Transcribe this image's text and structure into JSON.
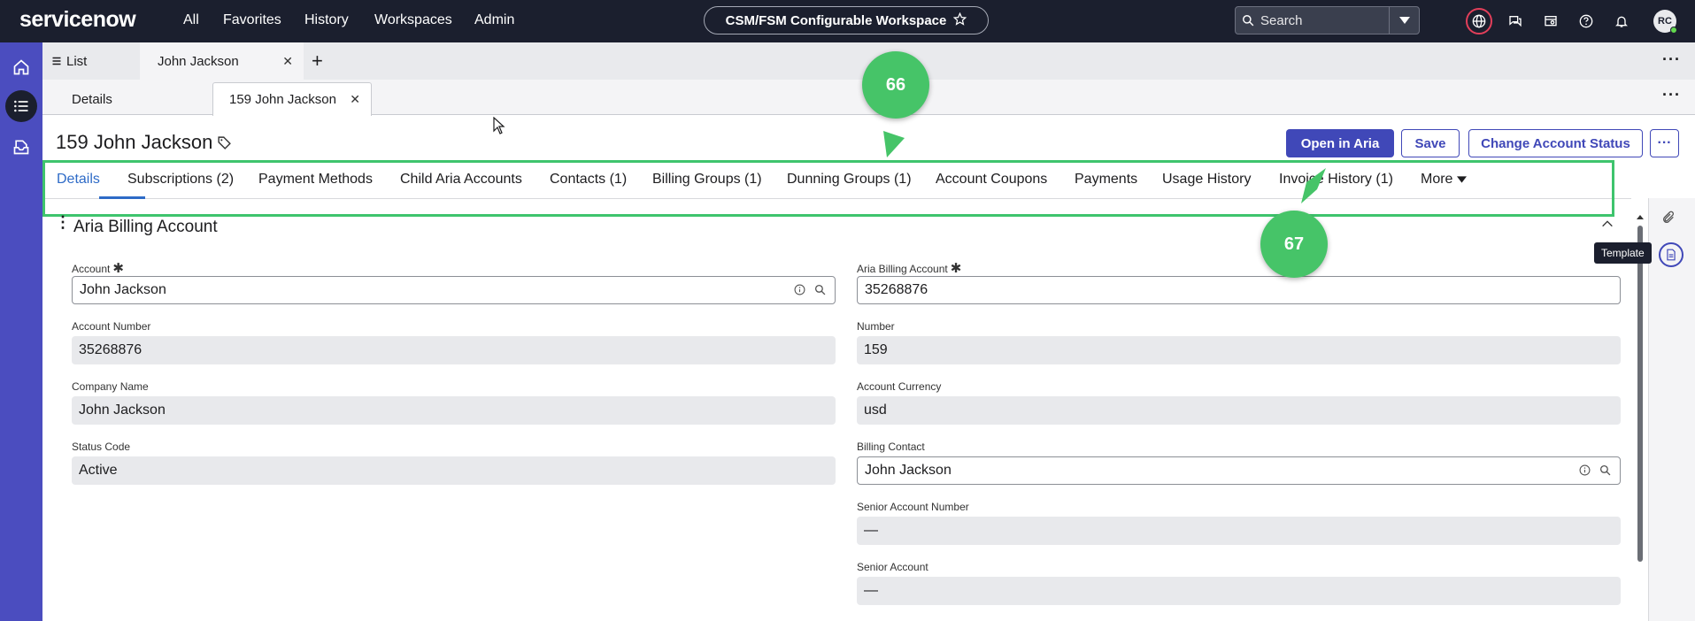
{
  "topnav": {
    "logo": "servicenow",
    "links": [
      "All",
      "Favorites",
      "History",
      "Workspaces",
      "Admin"
    ],
    "workspace": "CSM/FSM Configurable Workspace",
    "search_placeholder": "Search",
    "avatar": "RC"
  },
  "tabs_primary": [
    {
      "label": "List"
    },
    {
      "label": "John Jackson"
    }
  ],
  "tabs_secondary": [
    {
      "label": "Details"
    },
    {
      "label": "159 John Jackson"
    }
  ],
  "record": {
    "title": "159 John Jackson",
    "buttons": {
      "open_aria": "Open in Aria",
      "save": "Save",
      "change_status": "Change Account Status"
    }
  },
  "record_tabs": [
    "Details",
    "Subscriptions (2)",
    "Payment Methods",
    "Child Aria Accounts",
    "Contacts (1)",
    "Billing Groups (1)",
    "Dunning Groups (1)",
    "Account Coupons",
    "Payments",
    "Usage History",
    "Invoice History (1)",
    "More"
  ],
  "section": {
    "title": "Aria Billing Account"
  },
  "form": {
    "left": [
      {
        "label": "Account",
        "required": "✱",
        "value": "John Jackson"
      },
      {
        "label": "Account Number",
        "value": "35268876"
      },
      {
        "label": "Company Name",
        "value": "John Jackson"
      },
      {
        "label": "Status Code",
        "value": "Active"
      }
    ],
    "right": [
      {
        "label": "Aria Billing Account",
        "required": "✱",
        "value": "35268876"
      },
      {
        "label": "Number",
        "value": "159"
      },
      {
        "label": "Account Currency",
        "value": "usd"
      },
      {
        "label": "Billing Contact",
        "value": "John Jackson"
      },
      {
        "label": "Senior Account Number",
        "value": "—"
      },
      {
        "label": "Senior Account",
        "value": "—"
      }
    ]
  },
  "tooltip": "Template",
  "callouts": [
    "66",
    "67"
  ],
  "colors": {
    "nav_bg": "#1b1f2e",
    "rail_bg": "#4b4dbf",
    "primary_button": "#4048b8",
    "active_tab": "#2e6bc7",
    "callout": "#46c468"
  }
}
